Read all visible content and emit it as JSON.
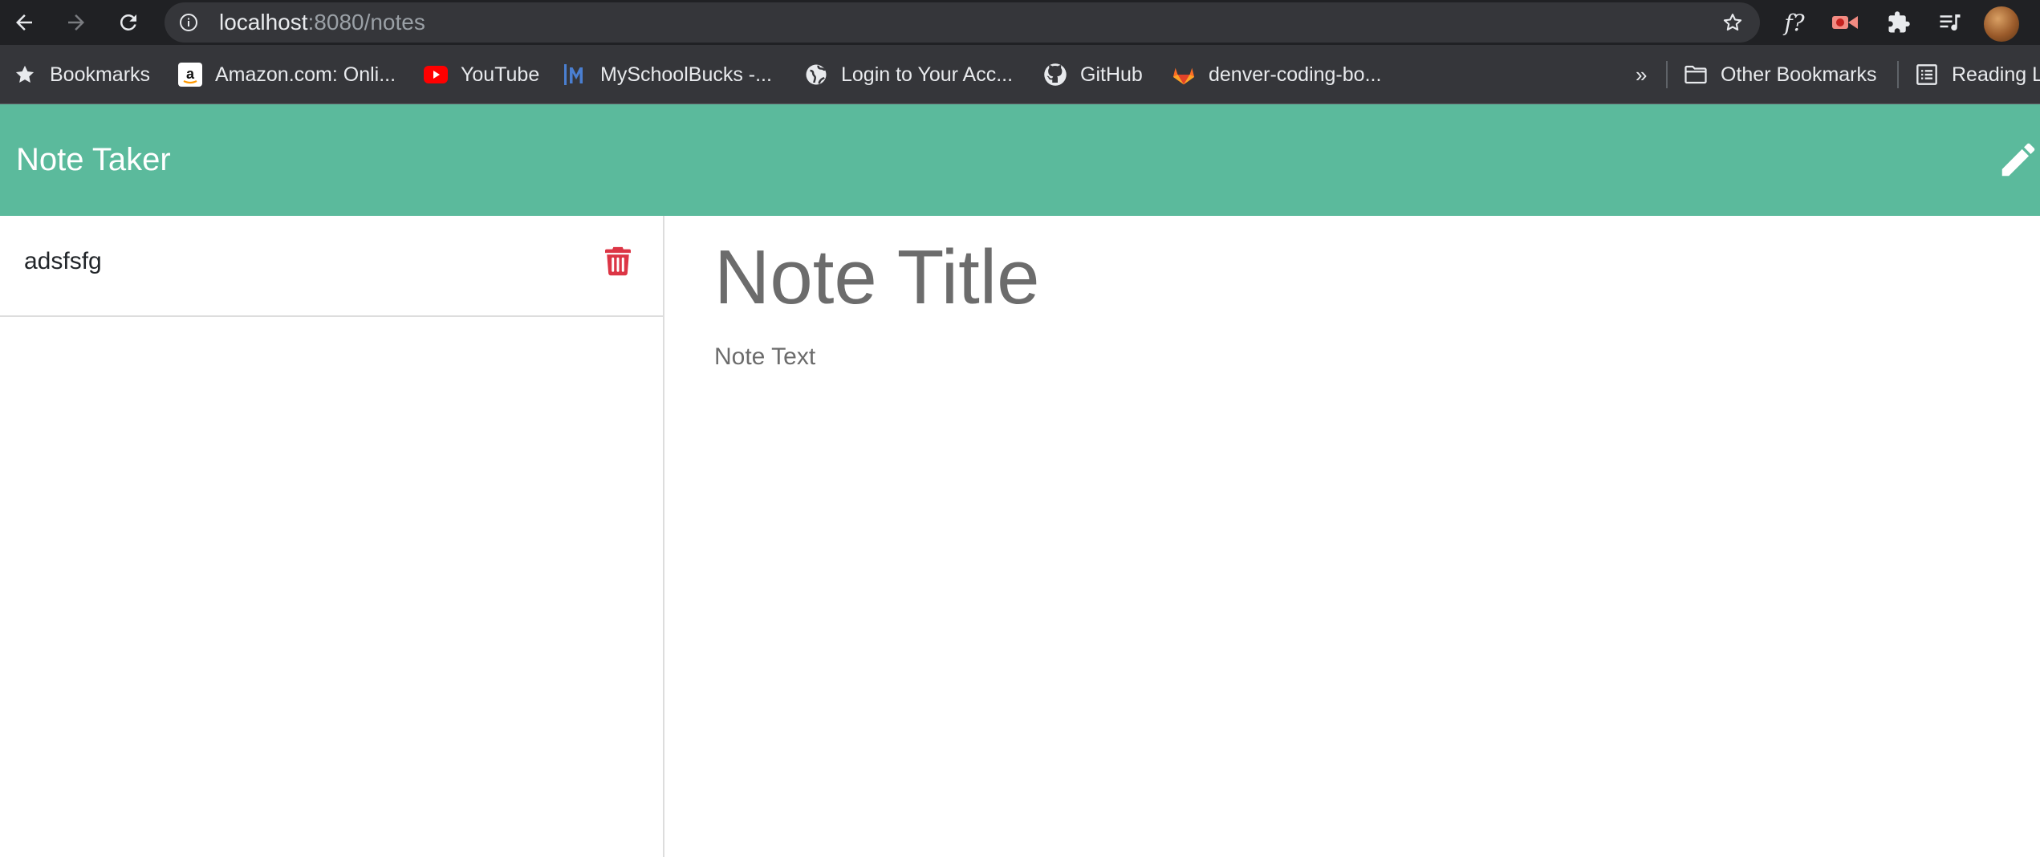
{
  "browser": {
    "url_host": "localhost",
    "url_path": ":8080/notes",
    "extensions": {
      "fx_label": "f?"
    },
    "icons": [
      "back-arrow-icon",
      "forward-arrow-icon",
      "reload-icon",
      "info-icon",
      "star-icon",
      "video-extension-icon",
      "puzzle-extensions-icon",
      "media-queue-icon",
      "avatar"
    ]
  },
  "bookmarks": {
    "items": [
      {
        "label": "Bookmarks",
        "icon": "star-icon"
      },
      {
        "label": "Amazon.com: Onli...",
        "icon": "amazon-icon"
      },
      {
        "label": "YouTube",
        "icon": "youtube-icon"
      },
      {
        "label": "MySchoolBucks -...",
        "icon": "myschoolbucks-icon"
      },
      {
        "label": "Login to Your Acc...",
        "icon": "globe-icon"
      },
      {
        "label": "GitHub",
        "icon": "github-icon"
      },
      {
        "label": "denver-coding-bo...",
        "icon": "gitlab-icon"
      }
    ],
    "overflow_label": "»",
    "other_label": "Other Bookmarks",
    "reading_label": "Reading L"
  },
  "app": {
    "title": "Note Taker",
    "header_color": "#5bba9c"
  },
  "notes": [
    {
      "title": "adsfsfg"
    }
  ],
  "editor": {
    "title_placeholder": "Note Title",
    "text_placeholder": "Note Text"
  },
  "colors": {
    "delete": "#dc3545",
    "chrome_dark": "#202124",
    "bookmarks_bg": "#35363a"
  }
}
